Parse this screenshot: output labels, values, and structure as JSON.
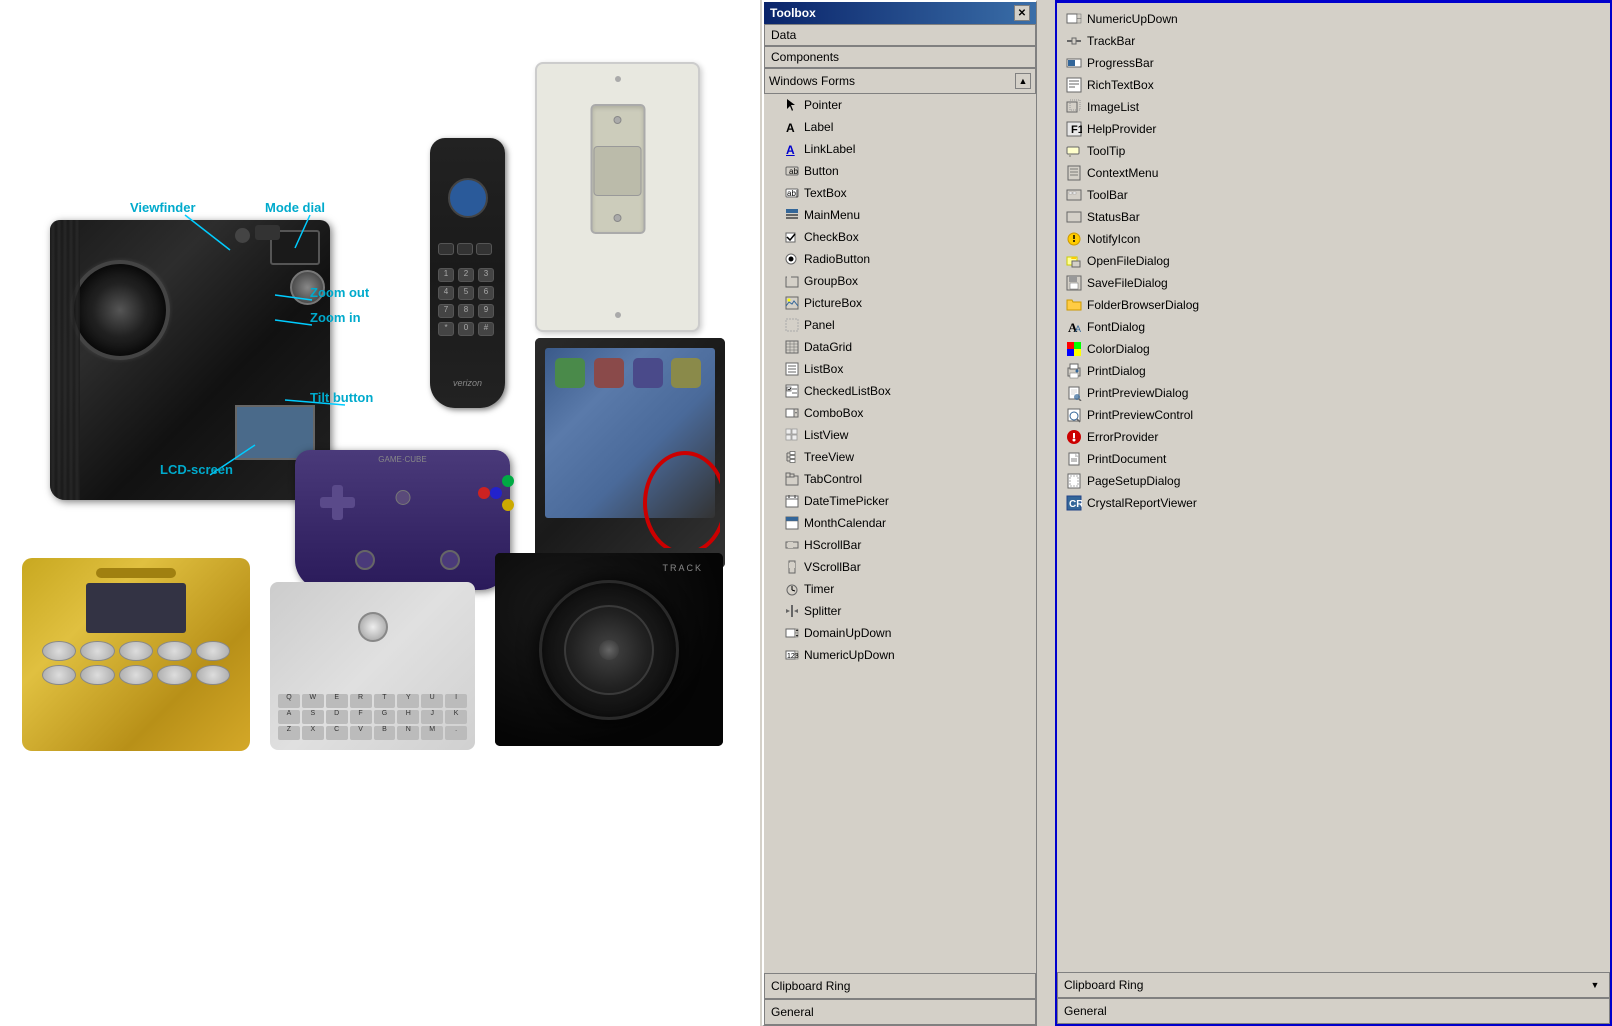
{
  "toolbox": {
    "title": "Toolbox",
    "sections": {
      "data_label": "Data",
      "components_label": "Components",
      "windows_forms_label": "Windows Forms"
    },
    "items": [
      {
        "id": "pointer",
        "label": "Pointer",
        "icon": "pointer"
      },
      {
        "id": "label",
        "label": "Label",
        "icon": "label"
      },
      {
        "id": "linklabel",
        "label": "LinkLabel",
        "icon": "linklabel"
      },
      {
        "id": "button",
        "label": "Button",
        "icon": "button"
      },
      {
        "id": "textbox",
        "label": "TextBox",
        "icon": "textbox"
      },
      {
        "id": "mainmenu",
        "label": "MainMenu",
        "icon": "mainmenu"
      },
      {
        "id": "checkbox",
        "label": "CheckBox",
        "icon": "checkbox"
      },
      {
        "id": "radiobutton",
        "label": "RadioButton",
        "icon": "radiobutton"
      },
      {
        "id": "groupbox",
        "label": "GroupBox",
        "icon": "groupbox"
      },
      {
        "id": "picturebox",
        "label": "PictureBox",
        "icon": "picturebox"
      },
      {
        "id": "panel",
        "label": "Panel",
        "icon": "panel"
      },
      {
        "id": "datagrid",
        "label": "DataGrid",
        "icon": "datagrid"
      },
      {
        "id": "listbox",
        "label": "ListBox",
        "icon": "listbox"
      },
      {
        "id": "checkedlistbox",
        "label": "CheckedListBox",
        "icon": "checkedlistbox"
      },
      {
        "id": "combobox",
        "label": "ComboBox",
        "icon": "combobox"
      },
      {
        "id": "listview",
        "label": "ListView",
        "icon": "listview"
      },
      {
        "id": "treeview",
        "label": "TreeView",
        "icon": "treeview"
      },
      {
        "id": "tabcontrol",
        "label": "TabControl",
        "icon": "tabcontrol"
      },
      {
        "id": "datetimepicker",
        "label": "DateTimePicker",
        "icon": "datetimepicker"
      },
      {
        "id": "monthcalendar",
        "label": "MonthCalendar",
        "icon": "monthcalendar"
      },
      {
        "id": "hscrollbar",
        "label": "HScrollBar",
        "icon": "hscrollbar"
      },
      {
        "id": "vscrollbar",
        "label": "VScrollBar",
        "icon": "vscrollbar"
      },
      {
        "id": "timer",
        "label": "Timer",
        "icon": "timer"
      },
      {
        "id": "splitter",
        "label": "Splitter",
        "icon": "splitter"
      },
      {
        "id": "domainupdown",
        "label": "DomainUpDown",
        "icon": "domainupdown"
      },
      {
        "id": "numericupdown",
        "label": "NumericUpDown",
        "icon": "numericupdown"
      }
    ],
    "bottom_sections": [
      {
        "id": "clipboard_ring",
        "label": "Clipboard Ring"
      },
      {
        "id": "general",
        "label": "General"
      }
    ]
  },
  "right_panel": {
    "items": [
      {
        "id": "numericupdown2",
        "label": "NumericUpDown",
        "icon": "numericupdown"
      },
      {
        "id": "trackbar",
        "label": "TrackBar",
        "icon": "trackbar"
      },
      {
        "id": "progressbar",
        "label": "ProgressBar",
        "icon": "progressbar"
      },
      {
        "id": "richtextbox",
        "label": "RichTextBox",
        "icon": "richtextbox"
      },
      {
        "id": "imagelist",
        "label": "ImageList",
        "icon": "imagelist"
      },
      {
        "id": "helpprovider",
        "label": "HelpProvider",
        "icon": "helpprovider"
      },
      {
        "id": "tooltip",
        "label": "ToolTip",
        "icon": "tooltip"
      },
      {
        "id": "contextmenu",
        "label": "ContextMenu",
        "icon": "contextmenu"
      },
      {
        "id": "toolbar",
        "label": "ToolBar",
        "icon": "toolbar"
      },
      {
        "id": "statusbar",
        "label": "StatusBar",
        "icon": "statusbar"
      },
      {
        "id": "notifyicon",
        "label": "NotifyIcon",
        "icon": "notifyicon"
      },
      {
        "id": "openfiledialog",
        "label": "OpenFileDialog",
        "icon": "openfiledialog"
      },
      {
        "id": "savefiledialog",
        "label": "SaveFileDialog",
        "icon": "savefiledialog"
      },
      {
        "id": "folderbrowserdialog",
        "label": "FolderBrowserDialog",
        "icon": "folderbrowserdialog"
      },
      {
        "id": "fontdialog",
        "label": "FontDialog",
        "icon": "fontdialog"
      },
      {
        "id": "colordialog",
        "label": "ColorDialog",
        "icon": "colordialog"
      },
      {
        "id": "printdialog",
        "label": "PrintDialog",
        "icon": "printdialog"
      },
      {
        "id": "printpreviewdialog",
        "label": "PrintPreviewDialog",
        "icon": "printpreviewdialog"
      },
      {
        "id": "printpreviewcontrol",
        "label": "PrintPreviewControl",
        "icon": "printpreviewcontrol"
      },
      {
        "id": "errorprovider",
        "label": "ErrorProvider",
        "icon": "errorprovider"
      },
      {
        "id": "printdocument",
        "label": "PrintDocument",
        "icon": "printdocument"
      },
      {
        "id": "pagesetupdialog",
        "label": "PageSetupDialog",
        "icon": "pagesetupdialog"
      },
      {
        "id": "crystalreportviewer",
        "label": "CrystalReportViewer",
        "icon": "crystalreportviewer"
      }
    ],
    "bottom_sections": [
      {
        "id": "clipboard_ring",
        "label": "Clipboard Ring"
      },
      {
        "id": "general",
        "label": "General"
      }
    ]
  },
  "annotations": {
    "viewfinder": "Viewfinder",
    "mode_dial": "Mode dial",
    "zoom_out": "Zoom out",
    "zoom_in": "Zoom in",
    "tilt_button": "Tilt button",
    "lcd_screen": "LCD-screen"
  }
}
